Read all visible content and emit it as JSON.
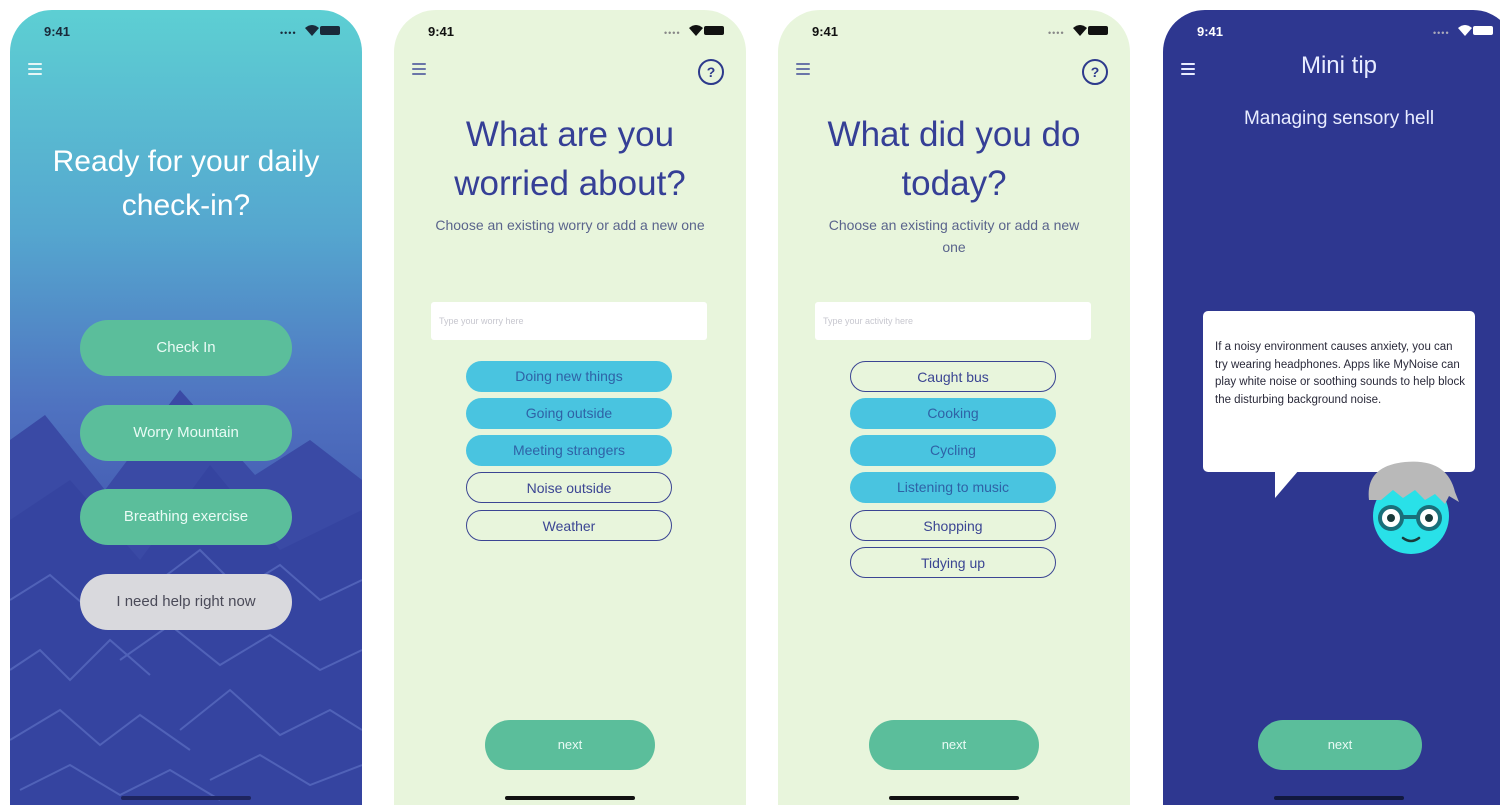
{
  "status": {
    "time": "9:41"
  },
  "screen1": {
    "title": "Ready for your daily check-in?",
    "buttons": [
      "Check In",
      "Worry Mountain",
      "Breathing exercise",
      "I need help right now"
    ]
  },
  "screen2": {
    "title": "What are you worried about?",
    "subtitle": "Choose an existing worry or add a new one",
    "placeholder": "Type your worry here",
    "chips": [
      {
        "label": "Doing new things",
        "selected": true
      },
      {
        "label": "Going outside",
        "selected": true
      },
      {
        "label": "Meeting strangers",
        "selected": true
      },
      {
        "label": "Noise outside",
        "selected": false
      },
      {
        "label": "Weather",
        "selected": false
      }
    ],
    "next_label": "next"
  },
  "screen3": {
    "title": "What did you do today?",
    "subtitle": "Choose an existing activity or add a new one",
    "placeholder": "Type your activity here",
    "chips": [
      {
        "label": "Caught bus",
        "selected": false
      },
      {
        "label": "Cooking",
        "selected": true
      },
      {
        "label": "Cycling",
        "selected": true
      },
      {
        "label": "Listening to music",
        "selected": true
      },
      {
        "label": "Shopping",
        "selected": false
      },
      {
        "label": "Tidying up",
        "selected": false
      }
    ],
    "next_label": "next"
  },
  "screen4": {
    "title": "Mini tip",
    "subtitle": "Managing sensory hell",
    "tip_text": "If a noisy environment causes anxiety, you can try wearing headphones. Apps like MyNoise can play white noise or soothing sounds to help block the disturbing background noise.",
    "next_label": "next"
  },
  "colors": {
    "accent_green": "#5bbe9b",
    "chip_selected": "#49c4e0",
    "navy": "#2e3790",
    "light_bg": "#e8f5dc"
  }
}
